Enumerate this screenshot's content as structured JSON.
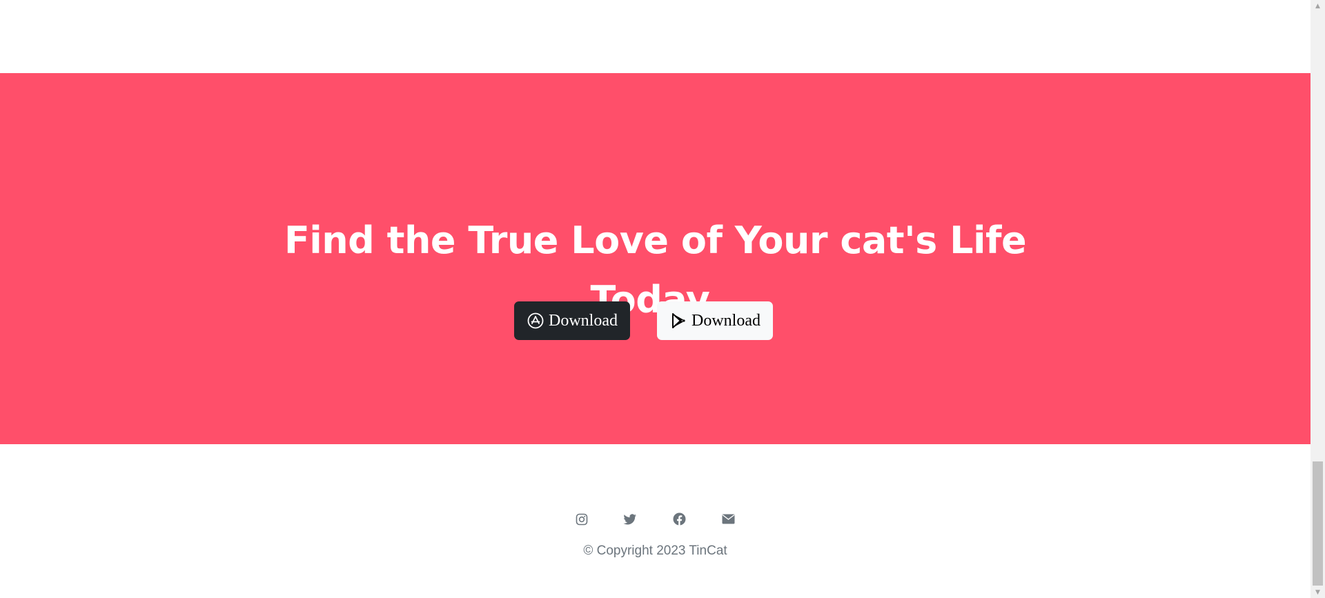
{
  "cta": {
    "title": "Find the True Love of Your cat's Life Today.",
    "background_color": "#ff4f6a",
    "buttons": [
      {
        "label": "Download",
        "icon": "app-store-icon",
        "style": "dark"
      },
      {
        "label": "Download",
        "icon": "google-play-icon",
        "style": "light"
      }
    ]
  },
  "footer": {
    "social": [
      {
        "icon": "instagram-icon"
      },
      {
        "icon": "twitter-icon"
      },
      {
        "icon": "facebook-icon"
      },
      {
        "icon": "envelope-icon"
      }
    ],
    "copyright": "© Copyright 2023 TinCat",
    "icon_color": "#6c757d"
  }
}
